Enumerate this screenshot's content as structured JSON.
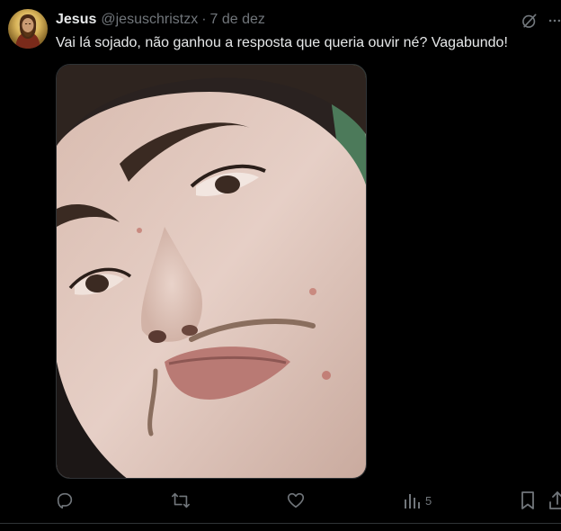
{
  "tweet": {
    "display_name": "Jesus",
    "handle": "@jesuschristzx",
    "separator": "·",
    "date": "7 de dez",
    "text": "Vai lá sojado, não ganhou a resposta que queria ouvir né? Vagabundo!"
  },
  "actions": {
    "views": "5"
  },
  "icons": {
    "avatar": "avatar-jesus-portrait",
    "grok": "grok-icon",
    "more": "more-icon",
    "reply": "reply-icon",
    "retweet": "retweet-icon",
    "like": "heart-icon",
    "views": "bar-chart-icon",
    "bookmark": "bookmark-icon",
    "share": "share-icon"
  },
  "colors": {
    "background": "#000000",
    "primary_text": "#e7e9ea",
    "secondary_text": "#71767b",
    "border": "#2f3336"
  }
}
